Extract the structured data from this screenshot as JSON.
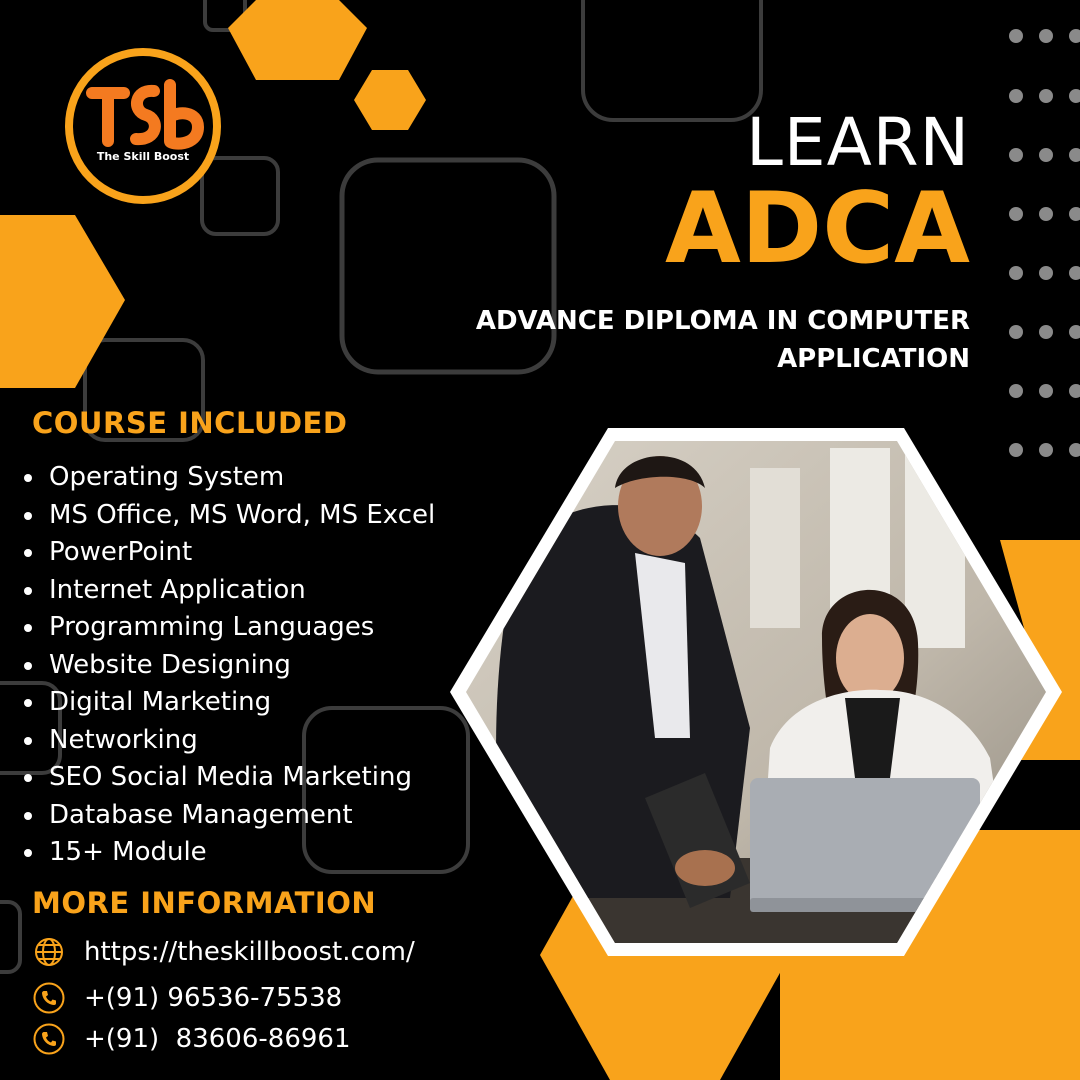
{
  "brand": {
    "logo_text": "The Skill Boost",
    "accent": "#f9a31b"
  },
  "headline": {
    "learn": "LEARN",
    "course": "ADCA",
    "subtitle_line1": "ADVANCE DIPLOMA IN COMPUTER",
    "subtitle_line2": "APPLICATION"
  },
  "course_section": {
    "heading": "COURSE INCLUDED",
    "items": [
      "Operating System",
      "MS Office, MS Word, MS Excel",
      "PowerPoint",
      "Internet Application",
      "Programming Languages",
      "Website Designing",
      "Digital Marketing",
      "Networking",
      "SEO Social Media Marketing",
      "Database Management",
      "15+ Module"
    ]
  },
  "info_section": {
    "heading": "MORE INFORMATION",
    "website": "https://theskillboost.com/",
    "phone1": "+(91) 96536-75538",
    "phone2": "+(91)  83606-86961"
  },
  "icons": [
    "globe-icon",
    "phone-icon",
    "phone-icon"
  ]
}
